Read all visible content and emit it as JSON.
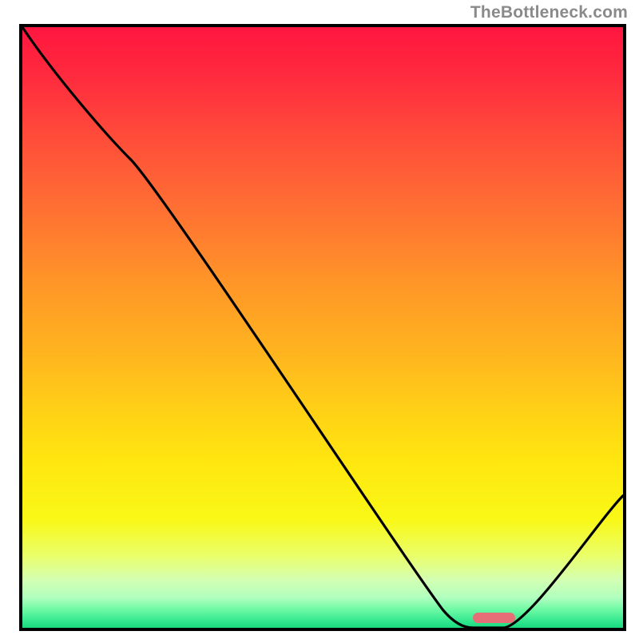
{
  "attribution": "TheBottleneck.com",
  "colors": {
    "curve": "#000000",
    "marker": "#e66f77",
    "border": "#000000",
    "gradient_top": "#ff163f",
    "gradient_bottom": "#19d97f"
  },
  "chart_data": {
    "type": "line",
    "title": "",
    "xlabel": "",
    "ylabel": "",
    "xlim": [
      0,
      100
    ],
    "ylim": [
      0,
      100
    ],
    "grid": false,
    "legend": false,
    "series": [
      {
        "name": "bottleneck-curve",
        "x": [
          0,
          18,
          70,
          75,
          80,
          100
        ],
        "values": [
          100,
          78,
          3,
          0,
          0,
          22
        ]
      }
    ],
    "marker": {
      "x_start": 75,
      "x_end": 82,
      "y": 1.6,
      "shape": "pill"
    },
    "annotations": []
  }
}
